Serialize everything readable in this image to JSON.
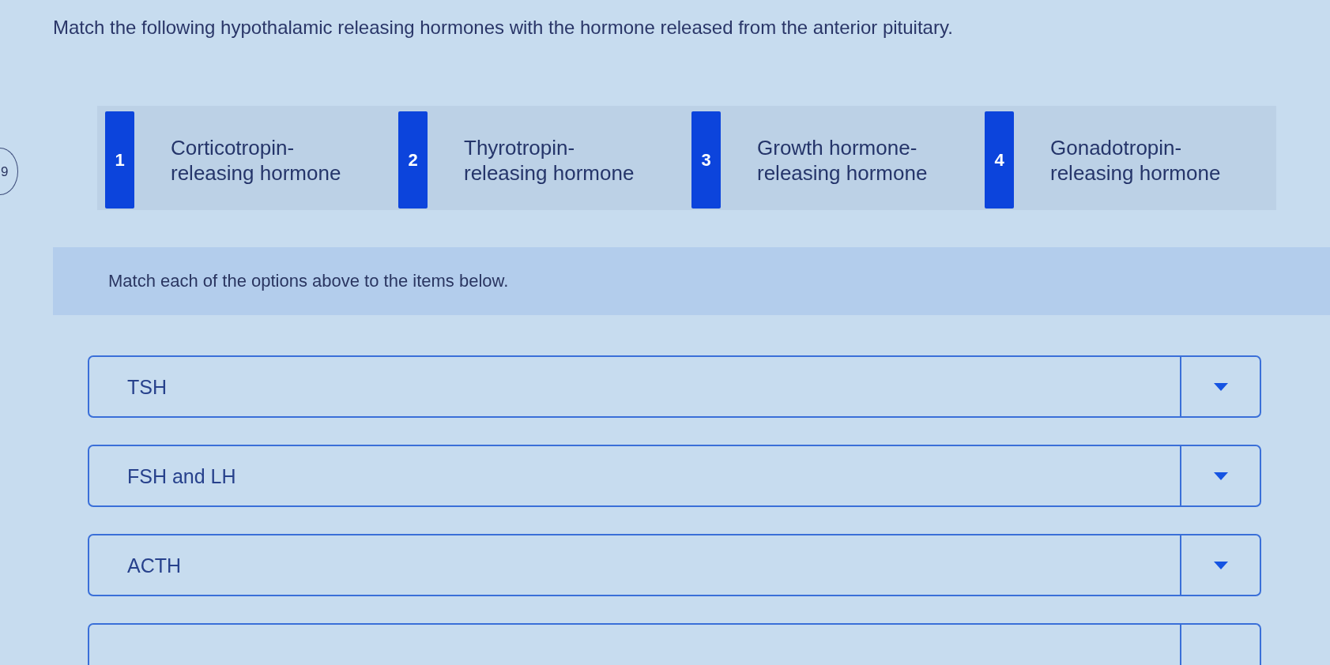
{
  "question": "Match the following hypothalamic releasing hormones with the hormone released from the anterior pituitary.",
  "question_number": "9",
  "options": [
    {
      "number": "1",
      "label": "Corticotropin-releasing hormone"
    },
    {
      "number": "2",
      "label": "Thyrotropin-releasing hormone"
    },
    {
      "number": "3",
      "label": "Growth hormone-releasing hormone"
    },
    {
      "number": "4",
      "label": "Gonadotropin-releasing hormone"
    }
  ],
  "instruction": "Match each of the options above to the items below.",
  "items": [
    {
      "label": "TSH",
      "cut_off": false
    },
    {
      "label": "FSH and LH",
      "cut_off": false
    },
    {
      "label": "ACTH",
      "cut_off": false
    },
    {
      "cut_off": true
    }
  ]
}
